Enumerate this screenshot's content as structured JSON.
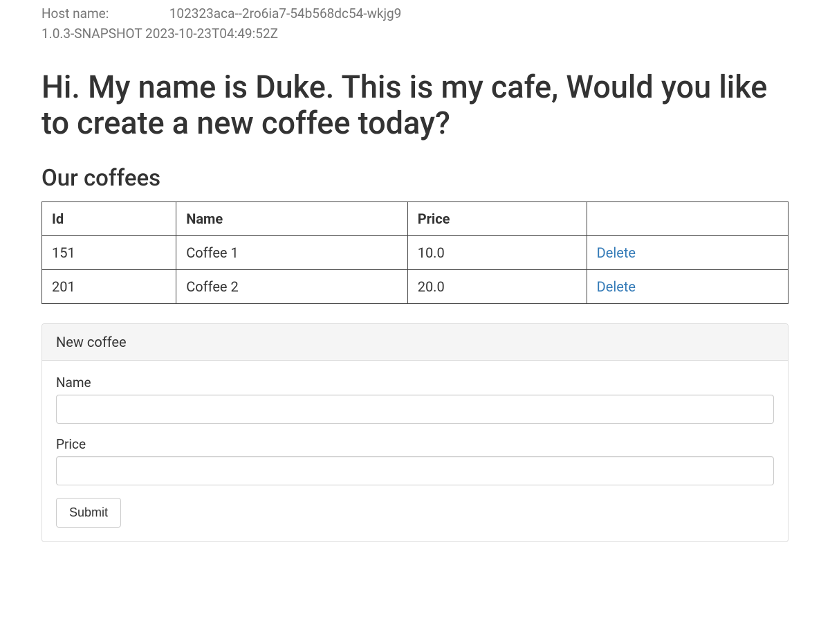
{
  "meta": {
    "hostname_label": "Host name:",
    "hostname_value": "102323aca--2ro6ia7-54b568dc54-wkjg9",
    "version": "1.0.3-SNAPSHOT",
    "build_timestamp": "2023-10-23T04:49:52Z"
  },
  "page": {
    "title": "Hi. My name is Duke. This is my cafe, Would you like to create a new coffee today?",
    "section_title": "Our coffees"
  },
  "table": {
    "headers": {
      "id": "Id",
      "name": "Name",
      "price": "Price",
      "action": ""
    },
    "rows": [
      {
        "id": "151",
        "name": "Coffee 1",
        "price": "10.0",
        "action": "Delete"
      },
      {
        "id": "201",
        "name": "Coffee 2",
        "price": "20.0",
        "action": "Delete"
      }
    ]
  },
  "form": {
    "panel_title": "New coffee",
    "name_label": "Name",
    "price_label": "Price",
    "name_value": "",
    "price_value": "",
    "submit_label": "Submit"
  }
}
